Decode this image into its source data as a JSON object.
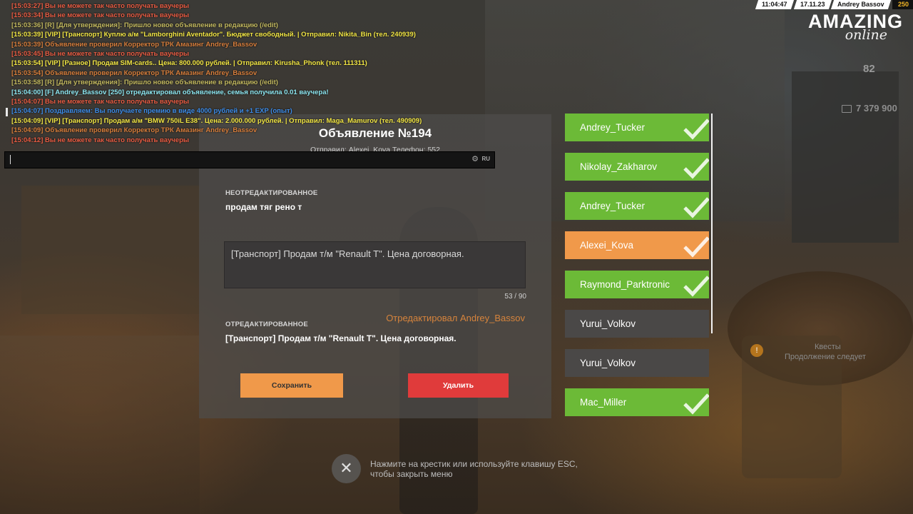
{
  "hud": {
    "time": "11:04:47",
    "date": "17.11.23",
    "player": "Andrey Bassov",
    "level": "250",
    "logo_main": "AMAZING",
    "logo_sub": "online",
    "stat": "82",
    "money": "7 379 900"
  },
  "quest": {
    "icon": "!",
    "title": "Квесты",
    "subtitle": "Продолжение следует"
  },
  "chat": {
    "lines": [
      {
        "text": "[15:03:27] Вы не можете так часто получать ваучеры",
        "color": "red"
      },
      {
        "text": "[15:03:34] Вы не можете так часто получать ваучеры",
        "color": "red"
      },
      {
        "text": "[15:03:36] [R] [Для утверждения]: Пришло новое объявление в редакцию (/edit)",
        "color": "olive"
      },
      {
        "text": "[15:03:39] [VIP] [Транспорт] Куплю а/м \"Lamborghini Aventador\". Бюджет свободный. | Отправил: Nikita_Bin (тел. 240939)",
        "color": "yellow"
      },
      {
        "text": "[15:03:39] Объявление проверил Корректор ТРК Амазинг Andrey_Bassov",
        "color": "orange"
      },
      {
        "text": "[15:03:45] Вы не можете так часто получать ваучеры",
        "color": "red"
      },
      {
        "text": "[15:03:54] [VIP] [Разное] Продам SIM-cards.. Цена: 800.000 рублей. | Отправил: Kirusha_Phonk (тел. 111311)",
        "color": "yellow"
      },
      {
        "text": "[15:03:54] Объявление проверил Корректор ТРК Амазинг Andrey_Bassov",
        "color": "orange"
      },
      {
        "text": "[15:03:58] [R] [Для утверждения]: Пришло новое объявление в редакцию (/edit)",
        "color": "olive"
      },
      {
        "text": "[15:04:00] [F] Andrey_Bassov [250] отредактировал объявление, семья получила 0.01 ваучера!",
        "color": "cyan"
      },
      {
        "text": "[15:04:07] Вы не можете так часто получать ваучеры",
        "color": "red"
      },
      {
        "text": "[15:04:07] Поздравляем: Вы получаете премию в виде 4000 рублей и +1 EXP (опыт)",
        "color": "blue"
      },
      {
        "text": "[15:04:09] [VIP] [Транспорт] Продам а/м \"BMW 750iL E38\". Цена: 2.000.000 рублей. | Отправил: Maga_Mamurov (тел. 490909)",
        "color": "yellow"
      },
      {
        "text": "[15:04:09] Объявление проверил Корректор ТРК Амазинг Andrey_Bassov",
        "color": "orange"
      },
      {
        "text": "[15:04:12] Вы не можете так часто получать ваучеры",
        "color": "red"
      }
    ],
    "input_value": "",
    "lang": "RU"
  },
  "ad": {
    "title": "Объявление №194",
    "sender": "Отправил: Alexei_Kova Телефон: 552",
    "unedited_label": "НЕОТРЕДАКТИРОВАННОЕ",
    "unedited_text": "продам тяг рено т",
    "edit_value": "[Транспорт] Продам т/м \"Renault T\". Цена договорная.",
    "counter": "53 / 90",
    "edited_by": "Отредактировал Andrey_Bassov",
    "edited_label": "ОТРЕДАКТИРОВАННОЕ",
    "edited_text": "[Транспорт] Продам т/м \"Renault T\". Цена договорная.",
    "save_label": "Сохранить",
    "delete_label": "Удалить"
  },
  "list": {
    "items": [
      {
        "name": "Andrey_Tucker",
        "status": "green",
        "checked": true
      },
      {
        "name": "Nikolay_Zakharov",
        "status": "green",
        "checked": true
      },
      {
        "name": "Andrey_Tucker",
        "status": "green",
        "checked": true
      },
      {
        "name": "Alexei_Kova",
        "status": "orange",
        "checked": true
      },
      {
        "name": "Raymond_Parktronic",
        "status": "green",
        "checked": true
      },
      {
        "name": "Yurui_Volkov",
        "status": "gray",
        "checked": false
      },
      {
        "name": "Yurui_Volkov",
        "status": "gray",
        "checked": false
      },
      {
        "name": "Mac_Miller",
        "status": "green",
        "checked": true
      }
    ]
  },
  "close": {
    "icon": "close-icon",
    "hint": "Нажмите на крестик или используйте клавишу ESC, чтобы закрыть меню"
  },
  "colors": {
    "green": "#6cba37",
    "orange": "#f0994a",
    "red": "#e03b3b",
    "gray": "#4a4847"
  }
}
